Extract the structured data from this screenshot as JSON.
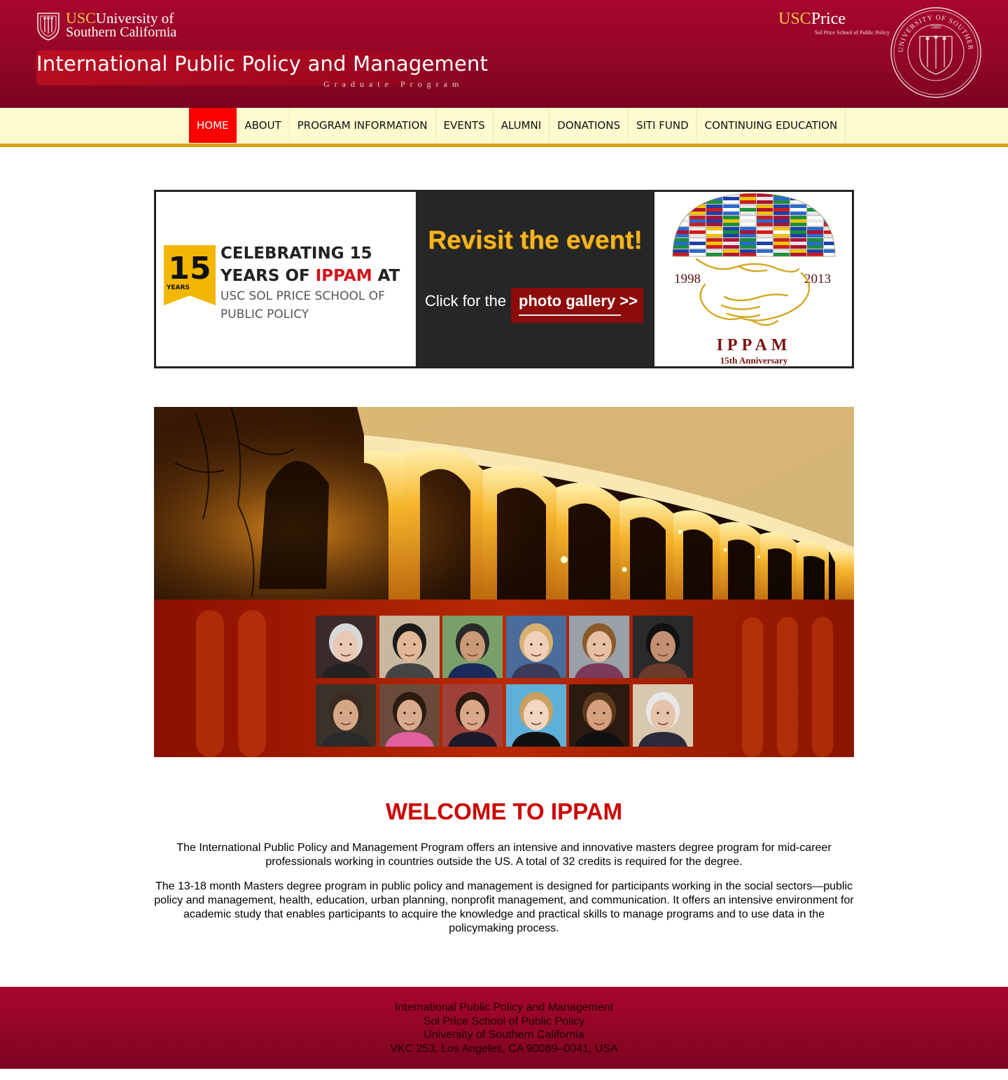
{
  "header": {
    "usc_logo": {
      "abbr": "USC",
      "line1_rest": "University of",
      "line2": "Southern California"
    },
    "site_title": "International Public Policy and Management",
    "site_subtitle": "Graduate Program",
    "price_logo": {
      "abbr": "USC",
      "rest": "Price",
      "sub": "Sol Price School of Public Policy"
    },
    "seal": {
      "ring_top": "UNIVERSITY OF SOUTHERN CALIFORNIA",
      "year": "1880"
    }
  },
  "nav": {
    "items": [
      {
        "label": "HOME",
        "active": true
      },
      {
        "label": "ABOUT",
        "active": false
      },
      {
        "label": "PROGRAM INFORMATION",
        "active": false
      },
      {
        "label": "EVENTS",
        "active": false
      },
      {
        "label": "ALUMNI",
        "active": false
      },
      {
        "label": "DONATIONS",
        "active": false
      },
      {
        "label": "SITI FUND",
        "active": false
      },
      {
        "label": "CONTINUING EDUCATION",
        "active": false
      }
    ]
  },
  "banner": {
    "ribbon_number": "15",
    "ribbon_word": "YEARS",
    "celebrate_line1": "CELEBRATING 15",
    "celebrate_line2_a": "YEARS OF ",
    "celebrate_line2_b": "IPPAM",
    "celebrate_line2_c": " AT",
    "celebrate_sub1": "USC SOL PRICE SCHOOL OF",
    "celebrate_sub2": "PUBLIC POLICY",
    "revisit": "Revisit the event!",
    "click_for": "Click for the",
    "gallery_button": "photo gallery >>",
    "anniv_year_start": "1998",
    "anniv_year_end": "2013",
    "anniv_name": "IPPAM",
    "anniv_label": "15th Anniversary"
  },
  "hero": {
    "faces_count": 12
  },
  "welcome": {
    "title": "WELCOME TO IPPAM",
    "para1": "The International Public Policy and Management Program offers an intensive and innovative masters degree program for mid-career professionals working in countries outside the US. A total of 32 credits is required for the degree.",
    "para2": "The 13-18 month Masters degree program in public policy and management is designed for participants working in the social sectors—public policy and management, health, education, urban planning, nonprofit management, and communication. It offers an intensive environment for academic study that enables participants to acquire the knowledge and practical skills to manage programs and to use data in the policymaking process."
  },
  "footer": {
    "line1": "International Public Policy and Management",
    "line2": "Sol Price School of Public Policy",
    "line3": "University of Southern California",
    "line4": "VKC 253, Los Angeles, CA   90089–0041, USA"
  },
  "colors": {
    "header_red": "#920626",
    "nav_bg": "#fffad0",
    "nav_active": "#ff0000",
    "nav_border": "#d4a017",
    "welcome_red": "#cc0000",
    "gold": "#f3c74a"
  }
}
